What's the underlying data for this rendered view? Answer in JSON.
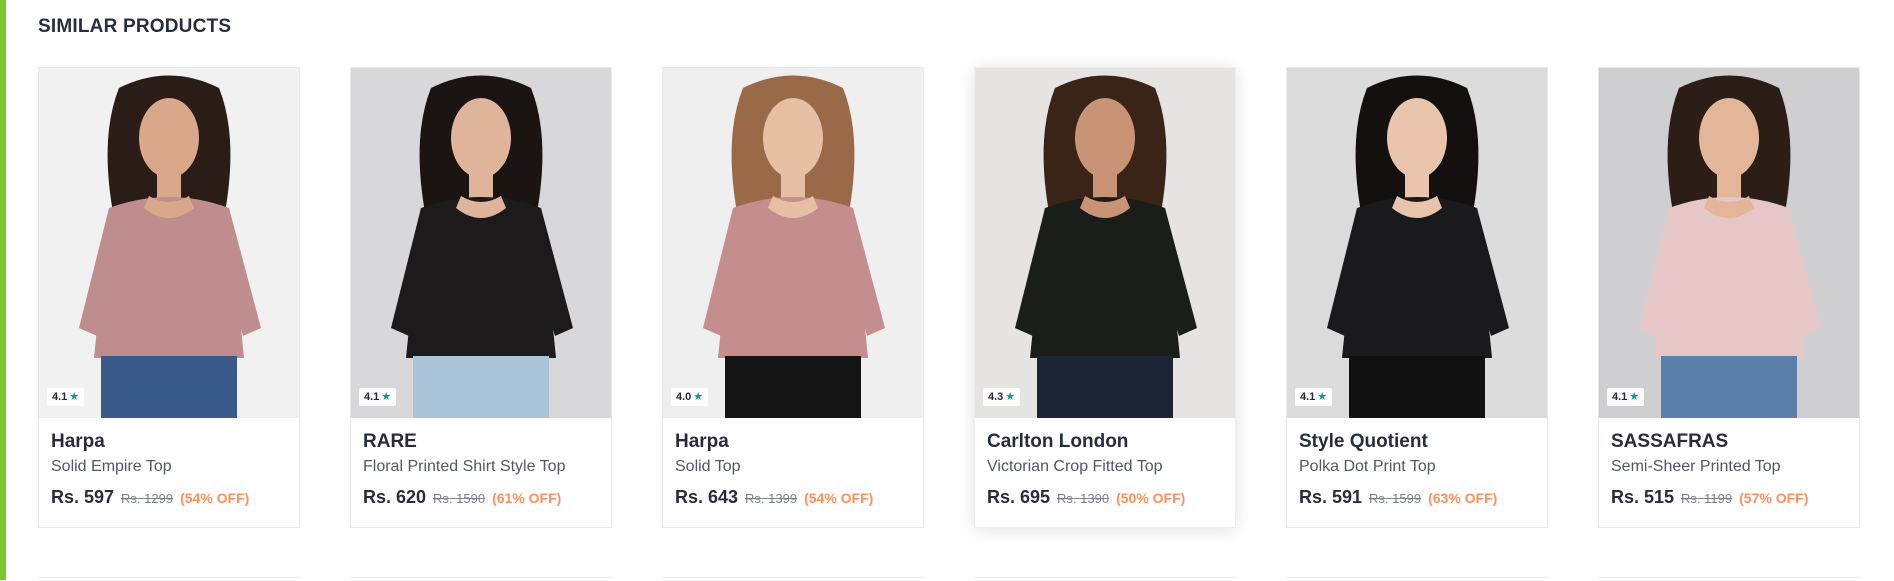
{
  "section": {
    "title": "SIMILAR PRODUCTS"
  },
  "colors": {
    "accent": "#7ac729",
    "rating_star": "#14958f",
    "discount": "#ff905a"
  },
  "products": [
    {
      "brand": "Harpa",
      "name": "Solid Empire Top",
      "price": "Rs. 597",
      "mrp": "Rs. 1299",
      "discount": "(54% OFF)",
      "rating": "4.1",
      "rating_icon": "star-icon",
      "bg": "#f1f1f1",
      "top_color": "#c08d8f",
      "bottom_color": "#3a5a8a",
      "hair": "#2a1c16",
      "skin": "#d9a88a"
    },
    {
      "brand": "RARE",
      "name": "Floral Printed Shirt Style Top",
      "price": "Rs. 620",
      "mrp": "Rs. 1590",
      "discount": "(61% OFF)",
      "rating": "4.1",
      "rating_icon": "star-icon",
      "bg": "#d8d8da",
      "top_color": "#1d1a1b",
      "bottom_color": "#a9c3d8",
      "hair": "#1a1412",
      "skin": "#e0b49a"
    },
    {
      "brand": "Harpa",
      "name": "Solid Top",
      "price": "Rs. 643",
      "mrp": "Rs. 1399",
      "discount": "(54% OFF)",
      "rating": "4.0",
      "rating_icon": "star-icon",
      "bg": "#efefef",
      "top_color": "#c48d8e",
      "bottom_color": "#141414",
      "hair": "#9a6a48",
      "skin": "#e6bfa4"
    },
    {
      "brand": "Carlton London",
      "name": "Victorian Crop Fitted Top",
      "price": "Rs. 695",
      "mrp": "Rs. 1390",
      "discount": "(50% OFF)",
      "rating": "4.3",
      "rating_icon": "star-icon",
      "bg": "#e6e4e2",
      "top_color": "#1b1d1a",
      "bottom_color": "#1d2436",
      "hair": "#3a2418",
      "skin": "#c99376"
    },
    {
      "brand": "Style Quotient",
      "name": "Polka Dot Print Top",
      "price": "Rs. 591",
      "mrp": "Rs. 1599",
      "discount": "(63% OFF)",
      "rating": "4.1",
      "rating_icon": "star-icon",
      "bg": "#dcdcdc",
      "top_color": "#1a1a1c",
      "bottom_color": "#111111",
      "hair": "#141010",
      "skin": "#e9c4ad"
    },
    {
      "brand": "SASSAFRAS",
      "name": "Semi-Sheer Printed Top",
      "price": "Rs. 515",
      "mrp": "Rs. 1199",
      "discount": "(57% OFF)",
      "rating": "4.1",
      "rating_icon": "star-icon",
      "bg": "#cfcfd1",
      "top_color": "#e7c6c8",
      "bottom_color": "#5a7fa8",
      "hair": "#2c1d16",
      "skin": "#e3b699"
    }
  ]
}
